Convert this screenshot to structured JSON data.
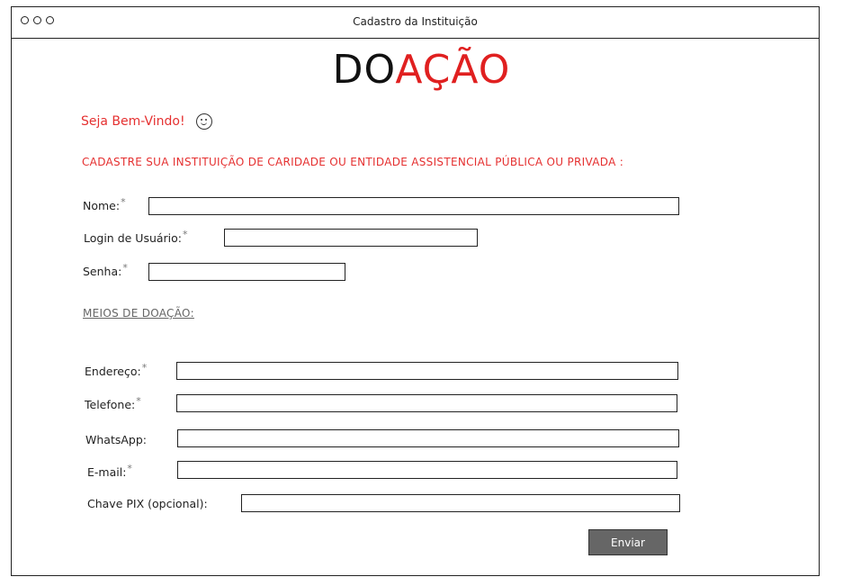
{
  "window": {
    "title": "Cadastro da Instituição"
  },
  "logo": {
    "part_black": "DO",
    "part_red": "AÇÃO"
  },
  "welcome": {
    "text": "Seja Bem-Vindo!"
  },
  "heading": "CADASTRE SUA INSTITUIÇÃO DE CARIDADE OU ENTIDADE ASSISTENCIAL PÚBLICA OU PRIVADA :",
  "required_mark": "*",
  "account": {
    "name_label": "Nome:",
    "name_value": "",
    "login_label": "Login de Usuário:",
    "login_value": "",
    "password_label": "Senha:",
    "password_value": ""
  },
  "donation_section": {
    "title": "MEIOS DE DOAÇÃO:",
    "address_label": "Endereço:",
    "address_value": "",
    "phone_label": "Telefone:",
    "phone_value": "",
    "whatsapp_label": "WhatsApp:",
    "whatsapp_value": "",
    "email_label": "E-mail:",
    "email_value": "",
    "pix_label": "Chave PIX (opcional):",
    "pix_value": ""
  },
  "submit_label": "Enviar",
  "colors": {
    "accent_red": "#e02020",
    "button_gray": "#666666"
  },
  "icons": {
    "welcome_icon": "smiley-face-icon"
  }
}
